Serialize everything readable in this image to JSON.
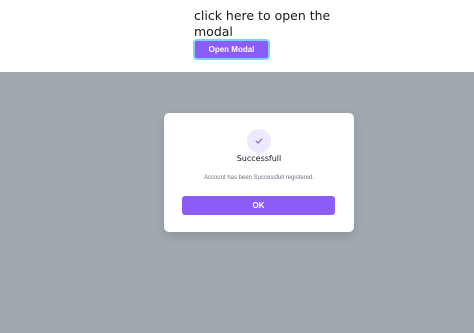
{
  "page": {
    "prompt_text": "click here to open the modal",
    "open_modal_label": "Open Modal"
  },
  "modal": {
    "icon": "check-icon",
    "title": "Successfull",
    "message": "Account has been Successfull registered.",
    "ok_label": "OK"
  },
  "colors": {
    "accent": "#8b5cf6",
    "focus_ring": "#7dd3fc",
    "overlay": "#a1a8b0",
    "icon_bg": "#ede9fe"
  }
}
